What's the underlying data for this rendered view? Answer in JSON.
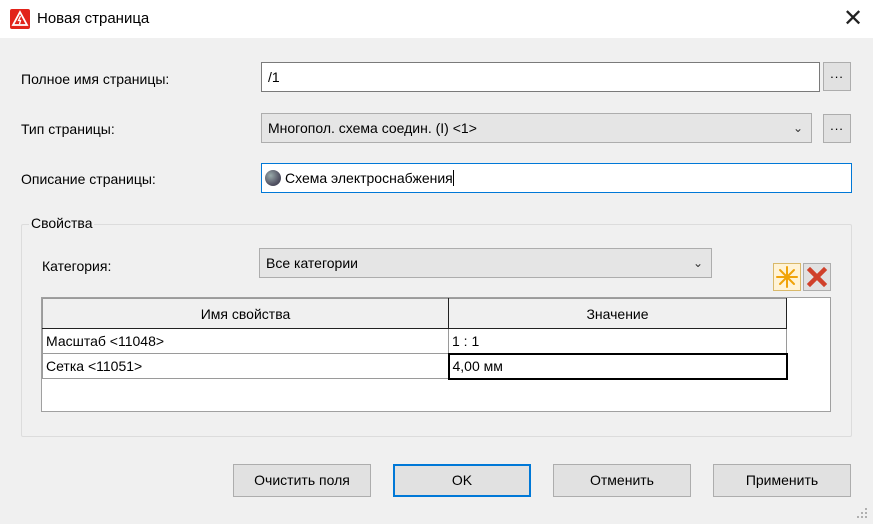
{
  "window": {
    "title": "Новая страница",
    "close_glyph": "✕"
  },
  "form": {
    "full_name_label": "Полное имя страницы:",
    "full_name_value": "/1",
    "full_name_browse": "...",
    "page_type_label": "Тип страницы:",
    "page_type_value": "Многопол. схема соедин. (I) <1>",
    "page_type_browse": "...",
    "description_label": "Описание страницы:",
    "description_value": "Схема электроснабжения"
  },
  "properties": {
    "group_title": "Свойства",
    "category_label": "Категория:",
    "category_value": "Все категории",
    "new_icon": "new-icon",
    "delete_icon": "delete-icon",
    "columns": [
      "Имя свойства",
      "Значение"
    ],
    "rows": [
      {
        "name": "Масштаб <11048>",
        "value": "1 : 1"
      },
      {
        "name": "Сетка <11051>",
        "value": "4,00 мм"
      }
    ]
  },
  "buttons": {
    "clear": "Очистить поля",
    "ok": "OK",
    "cancel": "Отменить",
    "apply": "Применить"
  },
  "colors": {
    "accent": "#0078d7",
    "app_icon": "#e2231a",
    "delete": "#d0402a",
    "new": "#f0a30a"
  }
}
